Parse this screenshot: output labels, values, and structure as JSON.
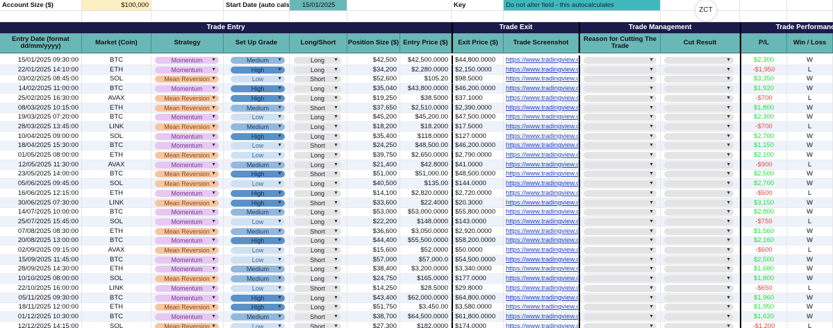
{
  "top": {
    "account_size_label": "Account Size ($)",
    "account_size_value": "$100,000",
    "start_date_label": "Start Date (auto cals)",
    "start_date_value": "15/01/2025",
    "key_label": "Key",
    "key_note": "Do not alter field - this autocalculates",
    "logo_text": "ZCT"
  },
  "sections": {
    "trade_entry": "Trade Entry",
    "trade_exit": "Trade Exit",
    "trade_management": "Trade Management",
    "trade_performance": "Trade Performance"
  },
  "columns": {
    "entry_date": "Entry Date (format dd/mm/yyyy)",
    "market": "Market (Coin)",
    "strategy": "Strategy",
    "setup_grade": "Set Up Grade",
    "long_short": "Long/Short",
    "position_size": "Position Size ($)",
    "entry_price": "Entry Price ($)",
    "exit_price": "Exit Price ($)",
    "trade_screenshot": "Trade Screenshot",
    "reason_cutting": "Reason for Cutting The Trade",
    "cut_result": "Cut Result",
    "pl": "P/L",
    "win_loss": "Win / Loss"
  },
  "colors": {
    "header_navy": "#1c1a4a",
    "header_teal": "#6ab7b7",
    "account_bg": "#fbeec2",
    "start_bg": "#6ab7b7",
    "key_bg": "#3fb8bd",
    "profit": "#1ee03a",
    "loss": "#e04a3a"
  },
  "trades": [
    {
      "date": "15/01/2025 09:30:00",
      "market": "BTC",
      "strategy": "Momentum",
      "grade": "Medium",
      "side": "Long",
      "size": "$42,500",
      "entry": "$42,500.0000",
      "exit": "$44,800.0000",
      "link": "https://www.tradingview.com",
      "pl": "$2,300",
      "wl": "W"
    },
    {
      "date": "22/01/2025 14:10:00",
      "market": "ETH",
      "strategy": "Momentum",
      "grade": "High",
      "side": "Long",
      "size": "$34,200",
      "entry": "$2,280.0000",
      "exit": "$2,150.0000",
      "link": "https://www.tradingview.com",
      "pl": "-$1,950",
      "wl": "L"
    },
    {
      "date": "03/02/2025 08:45:00",
      "market": "SOL",
      "strategy": "Mean Reversion",
      "grade": "Low",
      "side": "Short",
      "size": "$52,600",
      "entry": "$105.20",
      "exit": "$98.5000",
      "link": "https://www.tradingview.com",
      "pl": "$3,350",
      "wl": "W"
    },
    {
      "date": "14/02/2025 11:00:00",
      "market": "BTC",
      "strategy": "Momentum",
      "grade": "High",
      "side": "Long",
      "size": "$35,040",
      "entry": "$43,800.0000",
      "exit": "$46,200.0000",
      "link": "https://www.tradingview.com",
      "pl": "$1,920",
      "wl": "W"
    },
    {
      "date": "25/02/2025 16:30:00",
      "market": "AVAX",
      "strategy": "Mean Reversion",
      "grade": "High",
      "side": "Long",
      "size": "$19,250",
      "entry": "$38.5000",
      "exit": "$37.1000",
      "link": "https://www.tradingview.com",
      "pl": "-$700",
      "wl": "L"
    },
    {
      "date": "08/03/2025 10:15:00",
      "market": "ETH",
      "strategy": "Mean Reversion",
      "grade": "Medium",
      "side": "Short",
      "size": "$37,650",
      "entry": "$2,510.0000",
      "exit": "$2,390.0000",
      "link": "https://www.tradingview.com",
      "pl": "$1,800",
      "wl": "W"
    },
    {
      "date": "19/03/2025 07:20:00",
      "market": "BTC",
      "strategy": "Momentum",
      "grade": "Low",
      "side": "Long",
      "size": "$45,200",
      "entry": "$45,200.00",
      "exit": "$47,500.0000",
      "link": "https://www.tradingview.com",
      "pl": "$2,300",
      "wl": "W"
    },
    {
      "date": "28/03/2025 13:45:00",
      "market": "LINK",
      "strategy": "Mean Reversion",
      "grade": "Medium",
      "side": "Long",
      "size": "$18,200",
      "entry": "$18.2000",
      "exit": "$17.5000",
      "link": "https://www.tradingview.com",
      "pl": "-$700",
      "wl": "L"
    },
    {
      "date": "10/04/2025 09:00:00",
      "market": "SOL",
      "strategy": "Momentum",
      "grade": "High",
      "side": "Long",
      "size": "$35,400",
      "entry": "$118.0000",
      "exit": "$127.0000",
      "link": "https://www.tradingview.com",
      "pl": "$2,700",
      "wl": "W"
    },
    {
      "date": "18/04/2025 15:30:00",
      "market": "BTC",
      "strategy": "Momentum",
      "grade": "Low",
      "side": "Short",
      "size": "$24,250",
      "entry": "$48,500.00",
      "exit": "$46,200.0000",
      "link": "https://www.tradingview.com",
      "pl": "$1,150",
      "wl": "W"
    },
    {
      "date": "01/05/2025 08:00:00",
      "market": "ETH",
      "strategy": "Mean Reversion",
      "grade": "Low",
      "side": "Long",
      "size": "$39,750",
      "entry": "$2,650.0000",
      "exit": "$2,790.0000",
      "link": "https://www.tradingview.com",
      "pl": "$2,100",
      "wl": "W"
    },
    {
      "date": "12/05/2025 11:30:00",
      "market": "AVAX",
      "strategy": "Momentum",
      "grade": "Medium",
      "side": "Long",
      "size": "$21,400",
      "entry": "$42.8000",
      "exit": "$41.0000",
      "link": "https://www.tradingview.com",
      "pl": "-$900",
      "wl": "L"
    },
    {
      "date": "23/05/2025 14:00:00",
      "market": "BTC",
      "strategy": "Mean Reversion",
      "grade": "High",
      "side": "Short",
      "size": "$51,000",
      "entry": "$51,000.00",
      "exit": "$48,500.0000",
      "link": "https://www.tradingview.com",
      "pl": "$2,500",
      "wl": "W"
    },
    {
      "date": "05/06/2025 09:45:00",
      "market": "SOL",
      "strategy": "Mean Reversion",
      "grade": "Low",
      "side": "Long",
      "size": "$40,500",
      "entry": "$135.00",
      "exit": "$144.0000",
      "link": "https://www.tradingview.com",
      "pl": "$2,700",
      "wl": "W"
    },
    {
      "date": "16/06/2025 12:15:00",
      "market": "ETH",
      "strategy": "Momentum",
      "grade": "High",
      "side": "Long",
      "size": "$14,100",
      "entry": "$2,820.0000",
      "exit": "$2,720.0000",
      "link": "https://www.tradingview.com",
      "pl": "-$500",
      "wl": "L"
    },
    {
      "date": "30/06/2025 07:30:00",
      "market": "LINK",
      "strategy": "Mean Reversion",
      "grade": "High",
      "side": "Short",
      "size": "$33,600",
      "entry": "$22.4000",
      "exit": "$20.3000",
      "link": "https://www.tradingview.com",
      "pl": "$3,150",
      "wl": "W"
    },
    {
      "date": "14/07/2025 10:00:00",
      "market": "BTC",
      "strategy": "Momentum",
      "grade": "Medium",
      "side": "Long",
      "size": "$53,000",
      "entry": "$53,000.0000",
      "exit": "$55,800.0000",
      "link": "https://www.tradingview.com",
      "pl": "$2,800",
      "wl": "W"
    },
    {
      "date": "25/07/2025 15:45:00",
      "market": "SOL",
      "strategy": "Momentum",
      "grade": "Low",
      "side": "Long",
      "size": "$22,200",
      "entry": "$148.0000",
      "exit": "$143.0000",
      "link": "https://www.tradingview.com",
      "pl": "-$750",
      "wl": "L"
    },
    {
      "date": "07/08/2025 08:30:00",
      "market": "ETH",
      "strategy": "Mean Reversion",
      "grade": "Medium",
      "side": "Short",
      "size": "$36,600",
      "entry": "$3,050.0000",
      "exit": "$2,920.0000",
      "link": "https://www.tradingview.com",
      "pl": "$1,560",
      "wl": "W"
    },
    {
      "date": "20/08/2025 13:00:00",
      "market": "BTC",
      "strategy": "Momentum",
      "grade": "High",
      "side": "Long",
      "size": "$44,400",
      "entry": "$55,500.0000",
      "exit": "$58,200.0000",
      "link": "https://www.tradingview.com",
      "pl": "$2,160",
      "wl": "W"
    },
    {
      "date": "02/09/2025 09:15:00",
      "market": "AVAX",
      "strategy": "Mean Reversion",
      "grade": "Low",
      "side": "Long",
      "size": "$15,600",
      "entry": "$52.0000",
      "exit": "$50.0000",
      "link": "https://www.tradingview.com",
      "pl": "-$600",
      "wl": "L"
    },
    {
      "date": "15/09/2025 11:45:00",
      "market": "BTC",
      "strategy": "Momentum",
      "grade": "Low",
      "side": "Short",
      "size": "$57,000",
      "entry": "$57,000.0",
      "exit": "$54,500.0000",
      "link": "https://www.tradingview.com",
      "pl": "$2,500",
      "wl": "W"
    },
    {
      "date": "28/09/2025 14:30:00",
      "market": "ETH",
      "strategy": "Momentum",
      "grade": "Medium",
      "side": "Long",
      "size": "$38,400",
      "entry": "$3,200.0000",
      "exit": "$3,340.0000",
      "link": "https://www.tradingview.com",
      "pl": "$1,680",
      "wl": "W"
    },
    {
      "date": "10/10/2025 08:00:00",
      "market": "SOL",
      "strategy": "Mean Reversion",
      "grade": "Medium",
      "side": "Long",
      "size": "$24,750",
      "entry": "$165.0000",
      "exit": "$177.0000",
      "link": "https://www.tradingview.com",
      "pl": "$1,800",
      "wl": "W"
    },
    {
      "date": "22/10/2025 16:00:00",
      "market": "LINK",
      "strategy": "Momentum",
      "grade": "Low",
      "side": "Short",
      "size": "$14,250",
      "entry": "$28.5000",
      "exit": "$29.8000",
      "link": "https://www.tradingview.com",
      "pl": "-$650",
      "wl": "L"
    },
    {
      "date": "05/11/2025 09:30:00",
      "market": "BTC",
      "strategy": "Momentum",
      "grade": "High",
      "side": "Long",
      "size": "$43,400",
      "entry": "$62,000.0000",
      "exit": "$64,800.0000",
      "link": "https://www.tradingview.com",
      "pl": "$1,960",
      "wl": "W"
    },
    {
      "date": "18/11/2025 12:00:00",
      "market": "ETH",
      "strategy": "Mean Reversion",
      "grade": "High",
      "side": "Long",
      "size": "$51,750",
      "entry": "$3,450.00",
      "exit": "$3,580.0000",
      "link": "https://www.tradingview.com",
      "pl": "$1,950",
      "wl": "W"
    },
    {
      "date": "01/12/2025 10:30:00",
      "market": "BTC",
      "strategy": "Momentum",
      "grade": "Medium",
      "side": "Short",
      "size": "$38,700",
      "entry": "$64,500.0000",
      "exit": "$61,800.0000",
      "link": "https://www.tradingview.com",
      "pl": "$1,620",
      "wl": "W"
    },
    {
      "date": "12/12/2025 14:15:00",
      "market": "SOL",
      "strategy": "Mean Reversion",
      "grade": "Low",
      "side": "Short",
      "size": "$27,300",
      "entry": "$182.0000",
      "exit": "$174.0000",
      "link": "https://www.tradingview.com",
      "pl": "-$1,200",
      "wl": "L"
    }
  ]
}
